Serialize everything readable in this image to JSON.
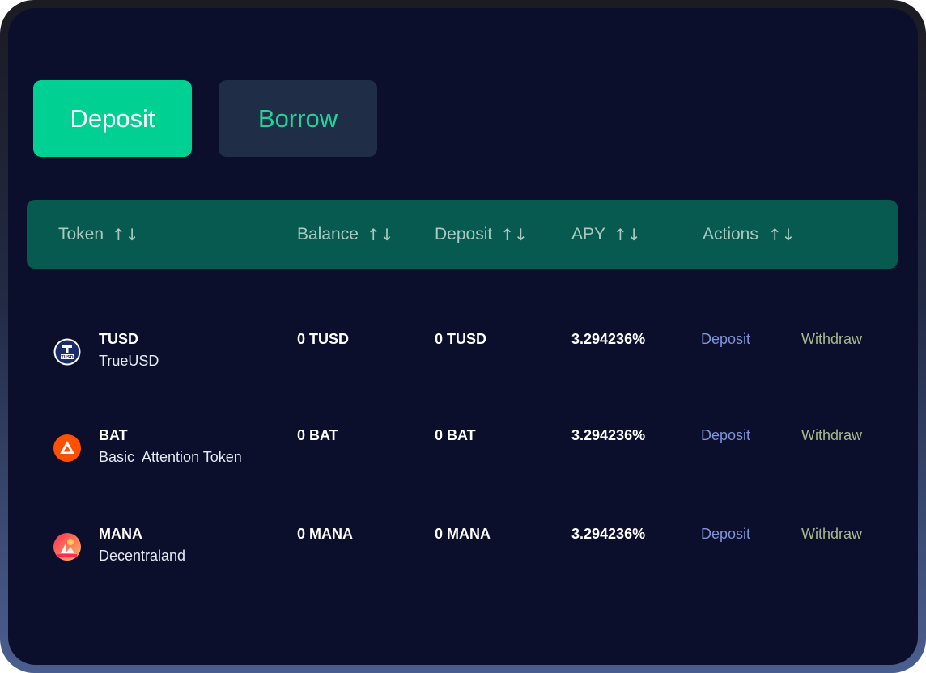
{
  "tabs": {
    "deposit_label": "Deposit",
    "borrow_label": "Borrow",
    "active": "Deposit"
  },
  "table": {
    "headers": {
      "token": "Token",
      "balance": "Balance",
      "deposit": "Deposit",
      "apy": "APY",
      "actions": "Actions"
    },
    "sort_glyph": "↑↓",
    "rows": [
      {
        "symbol": "TUSD",
        "name": "TrueUSD",
        "icon": "tusd-icon",
        "balance": "0 TUSD",
        "deposit": "0 TUSD",
        "apy": "3.294236%",
        "action_deposit": "Deposit",
        "action_withdraw": "Withdraw"
      },
      {
        "symbol": "BAT",
        "name": "Basic  Attention Token",
        "icon": "bat-icon",
        "balance": "0 BAT",
        "deposit": "0 BAT",
        "apy": "3.294236%",
        "action_deposit": "Deposit",
        "action_withdraw": "Withdraw"
      },
      {
        "symbol": "MANA",
        "name": "Decentraland",
        "icon": "mana-icon",
        "balance": "0 MANA",
        "deposit": "0 MANA",
        "apy": "3.294236%",
        "action_deposit": "Deposit",
        "action_withdraw": "Withdraw"
      }
    ]
  },
  "colors": {
    "accent": "#00d091",
    "panel_bg": "#0b0f2b",
    "header_bg": "#075a4f",
    "borrow_bg": "#1f2d46",
    "deposit_link": "#7f93d8",
    "withdraw_link": "#a9b68f"
  }
}
